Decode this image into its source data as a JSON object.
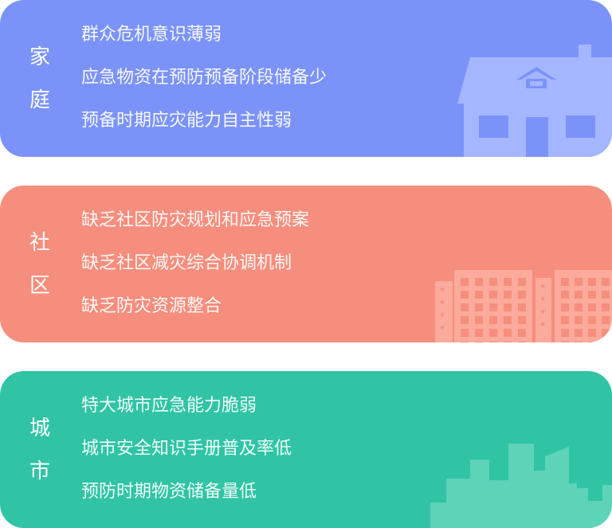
{
  "cards": [
    {
      "key": "family",
      "label": [
        "家",
        "庭"
      ],
      "items": [
        "群众危机意识薄弱",
        "应急物资在预防预备阶段储备少",
        "预备时期应灾能力自主性弱"
      ],
      "color": "#7b93f9",
      "icon": "house-icon"
    },
    {
      "key": "community",
      "label": [
        "社",
        "区"
      ],
      "items": [
        "缺乏社区防灾规划和应急预案",
        "缺乏社区减灾综合协调机制",
        "缺乏防灾资源整合"
      ],
      "color": "#f68e7d",
      "icon": "buildings-icon"
    },
    {
      "key": "city",
      "label": [
        "城",
        "市"
      ],
      "items": [
        "特大城市应急能力脆弱",
        "城市安全知识手册普及率低",
        "预防时期物资储备量低"
      ],
      "color": "#30c4a5",
      "icon": "city-skyline-icon"
    }
  ]
}
